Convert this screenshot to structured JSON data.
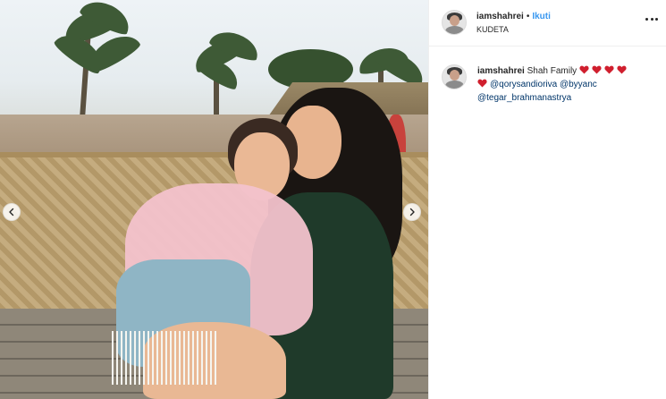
{
  "post": {
    "header": {
      "username": "iamshahrei",
      "separator": "•",
      "follow_label": "Ikuti",
      "location": "KUDETA",
      "more_icon": "more-horizontal-icon"
    },
    "caption": {
      "username": "iamshahrei",
      "text": "Shah Family",
      "hearts_count": 5,
      "mentions": [
        "@qorysandioriva",
        "@byyanc",
        "@tegar_brahmanastrya"
      ]
    },
    "photo": {
      "nav_left_icon": "chevron-left-icon",
      "nav_right_icon": "chevron-right-icon"
    }
  },
  "colors": {
    "follow": "#3897f0",
    "mention": "#003569",
    "heart": "#d01f2e",
    "text": "#262626",
    "divider": "#efefef"
  }
}
